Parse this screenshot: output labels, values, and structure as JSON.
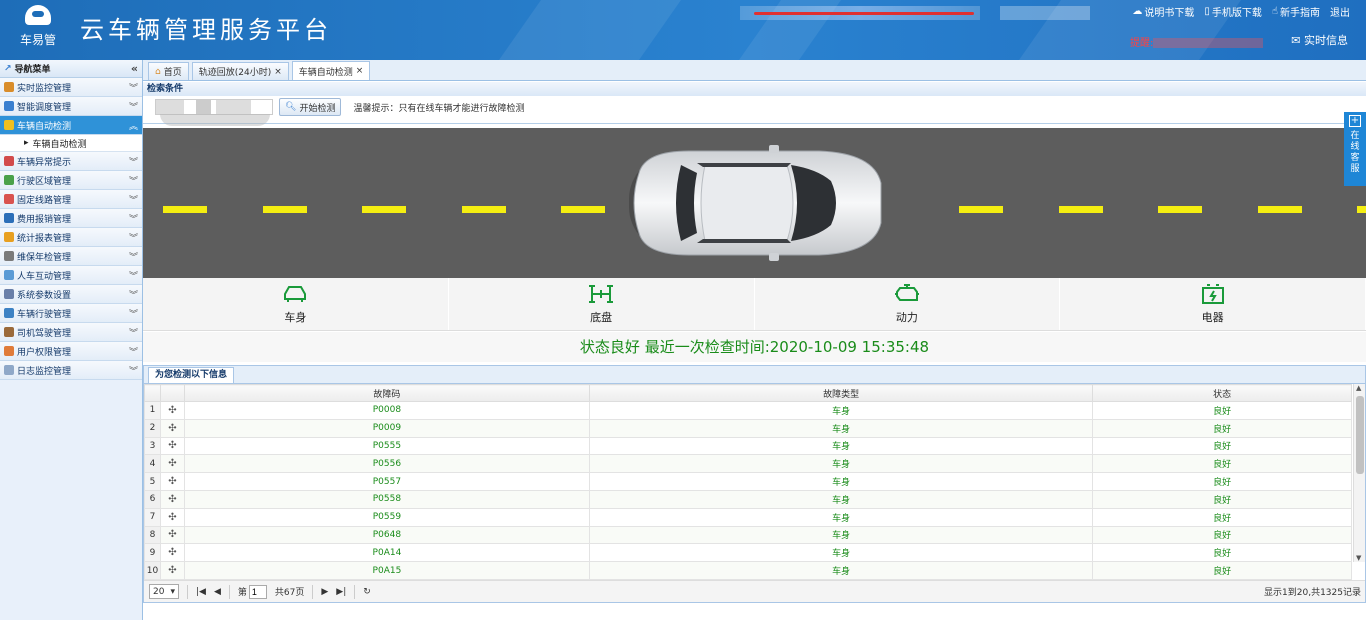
{
  "header": {
    "logo_text": "车易管",
    "app_title": "云车辆管理服务平台",
    "links": [
      "说明书下载",
      "手机版下载",
      "新手指南",
      "退出"
    ],
    "tip_label": "提醒:",
    "realtime": "实时信息"
  },
  "sidebar": {
    "title": "导航菜单",
    "items": [
      {
        "label": "实时监控管理",
        "color": "#d98d2b"
      },
      {
        "label": "智能调度管理",
        "color": "#3a7fcf"
      },
      {
        "label": "车辆自动检测",
        "color": "#f0c020"
      },
      {
        "label": "车辆异常提示",
        "color": "#d24b4b"
      },
      {
        "label": "行驶区域管理",
        "color": "#4aa14a"
      },
      {
        "label": "固定线路管理",
        "color": "#d9534f"
      },
      {
        "label": "费用报销管理",
        "color": "#2c6fb8"
      },
      {
        "label": "统计报表管理",
        "color": "#e8a020"
      },
      {
        "label": "维保年检管理",
        "color": "#7a7a7a"
      },
      {
        "label": "人车互动管理",
        "color": "#5b9bd5"
      },
      {
        "label": "系统参数设置",
        "color": "#6a7fa8"
      },
      {
        "label": "车辆行驶管理",
        "color": "#3d82c4"
      },
      {
        "label": "司机驾驶管理",
        "color": "#9b6a3a"
      },
      {
        "label": "用户权限管理",
        "color": "#e07b39"
      },
      {
        "label": "日志监控管理",
        "color": "#8fa8c8"
      }
    ],
    "active_sub": "车辆自动检测"
  },
  "tabs": [
    {
      "label": "首页"
    },
    {
      "label": "轨迹回放(24小时)"
    },
    {
      "label": "车辆自动检测"
    }
  ],
  "search": {
    "title": "检索条件",
    "button": "开始检测",
    "hint": "温馨提示：只有在线车辆才能进行故障检测"
  },
  "categories": [
    "车身",
    "底盘",
    "动力",
    "电器"
  ],
  "status_line": "状态良好 最近一次检查时间:2020-10-09 15:35:48",
  "grid": {
    "title": "为您检测以下信息",
    "columns": [
      "故障码",
      "故障类型",
      "状态"
    ],
    "rows": [
      {
        "n": "1",
        "code": "P0008",
        "type": "车身",
        "status": "良好"
      },
      {
        "n": "2",
        "code": "P0009",
        "type": "车身",
        "status": "良好"
      },
      {
        "n": "3",
        "code": "P0555",
        "type": "车身",
        "status": "良好"
      },
      {
        "n": "4",
        "code": "P0556",
        "type": "车身",
        "status": "良好"
      },
      {
        "n": "5",
        "code": "P0557",
        "type": "车身",
        "status": "良好"
      },
      {
        "n": "6",
        "code": "P0558",
        "type": "车身",
        "status": "良好"
      },
      {
        "n": "7",
        "code": "P0559",
        "type": "车身",
        "status": "良好"
      },
      {
        "n": "8",
        "code": "P0648",
        "type": "车身",
        "status": "良好"
      },
      {
        "n": "9",
        "code": "P0A14",
        "type": "车身",
        "status": "良好"
      },
      {
        "n": "10",
        "code": "P0A15",
        "type": "车身",
        "status": "良好"
      }
    ]
  },
  "pager": {
    "page_size": "20",
    "page_prefix": "第",
    "page": "1",
    "total_pages": "共67页",
    "info": "显示1到20,共1325记录"
  },
  "kefu": "在线客服",
  "colors": {
    "accent": "#2f92d8",
    "ok_green": "#1a8c1a",
    "road": "#5d5d5d",
    "lane": "#f4ee11"
  }
}
